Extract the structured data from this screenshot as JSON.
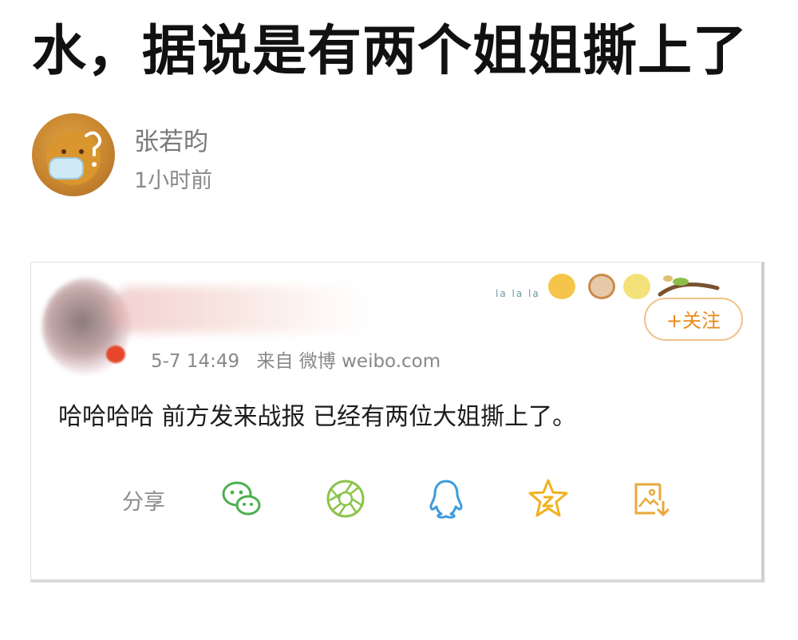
{
  "title": "水，据说是有两个姐姐撕上了",
  "author": {
    "name": "张若昀",
    "time": "1小时前"
  },
  "card": {
    "date": "5-7 14:49",
    "source": "来自 微博 weibo.com",
    "deco_text": "la la la",
    "follow_label": "+关注",
    "text": "哈哈哈哈 前方发来战报 已经有两位大姐撕上了。",
    "share_label": "分享"
  },
  "share_icons": [
    "wechat-icon",
    "moments-icon",
    "qq-icon",
    "qzone-icon",
    "save-image-icon"
  ],
  "colors": {
    "follow": "#e88a1a",
    "wechat": "#4caf50",
    "moments": "#8bc34a",
    "qq": "#3d9bdc",
    "qzone": "#f2b01e",
    "save": "#e9a93b"
  }
}
